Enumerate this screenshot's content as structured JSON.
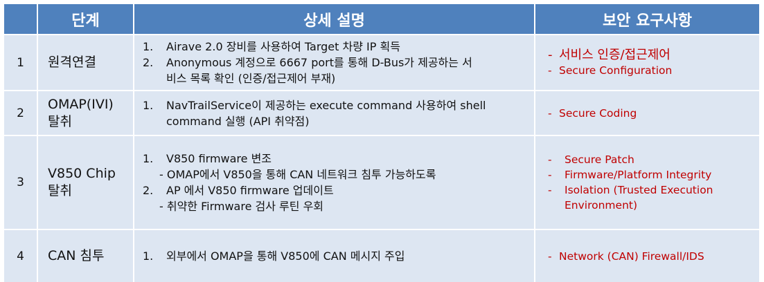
{
  "headers": {
    "step": "단계",
    "detail": "상세 설명",
    "security": "보안 요구사항"
  },
  "rows": [
    {
      "num": "1",
      "step": "원격연결",
      "items": [
        {
          "n": "1.",
          "text": "Airave 2.0 장비를 사용하여 Target 차량 IP 획득"
        },
        {
          "n": "2.",
          "text": "Anonymous 계정으로 6667 port를 통해 D-Bus가 제공하는 서",
          "cont": "비스 목록 확인 (인증/접근제어 부재)"
        }
      ],
      "reqs": [
        "서비스 인증/접근제어",
        "Secure Configuration"
      ]
    },
    {
      "num": "2",
      "step_line1": "OMAP(IVI)",
      "step_line2": "탈취",
      "items": [
        {
          "n": "1.",
          "text": "NavTrailService이 제공하는 execute command 사용하여 shell",
          "cont": "command 실행 (API 취약점)"
        }
      ],
      "reqs": [
        "Secure Coding"
      ]
    },
    {
      "num": "3",
      "step_line1": "V850 Chip",
      "step_line2": "탈취",
      "items": [
        {
          "n": "1.",
          "text": "V850 firmware 변조",
          "sub": "- OMAP에서 V850을 통해 CAN 네트워크 침투 가능하도록"
        },
        {
          "n": "2.",
          "text": "AP 에서 V850 firmware 업데이트",
          "sub": "- 취약한 Firmware 검사 루틴 우회"
        }
      ],
      "reqs": [
        "Secure Patch",
        "Firmware/Platform Integrity",
        "Isolation  (Trusted Execution",
        "Environment)"
      ]
    },
    {
      "num": "4",
      "step": "CAN 침투",
      "items": [
        {
          "n": "1.",
          "text": "외부에서 OMAP을 통해 V850에 CAN 메시지 주입"
        }
      ],
      "reqs": [
        "Network (CAN) Firewall/IDS"
      ]
    }
  ],
  "dash": "-"
}
